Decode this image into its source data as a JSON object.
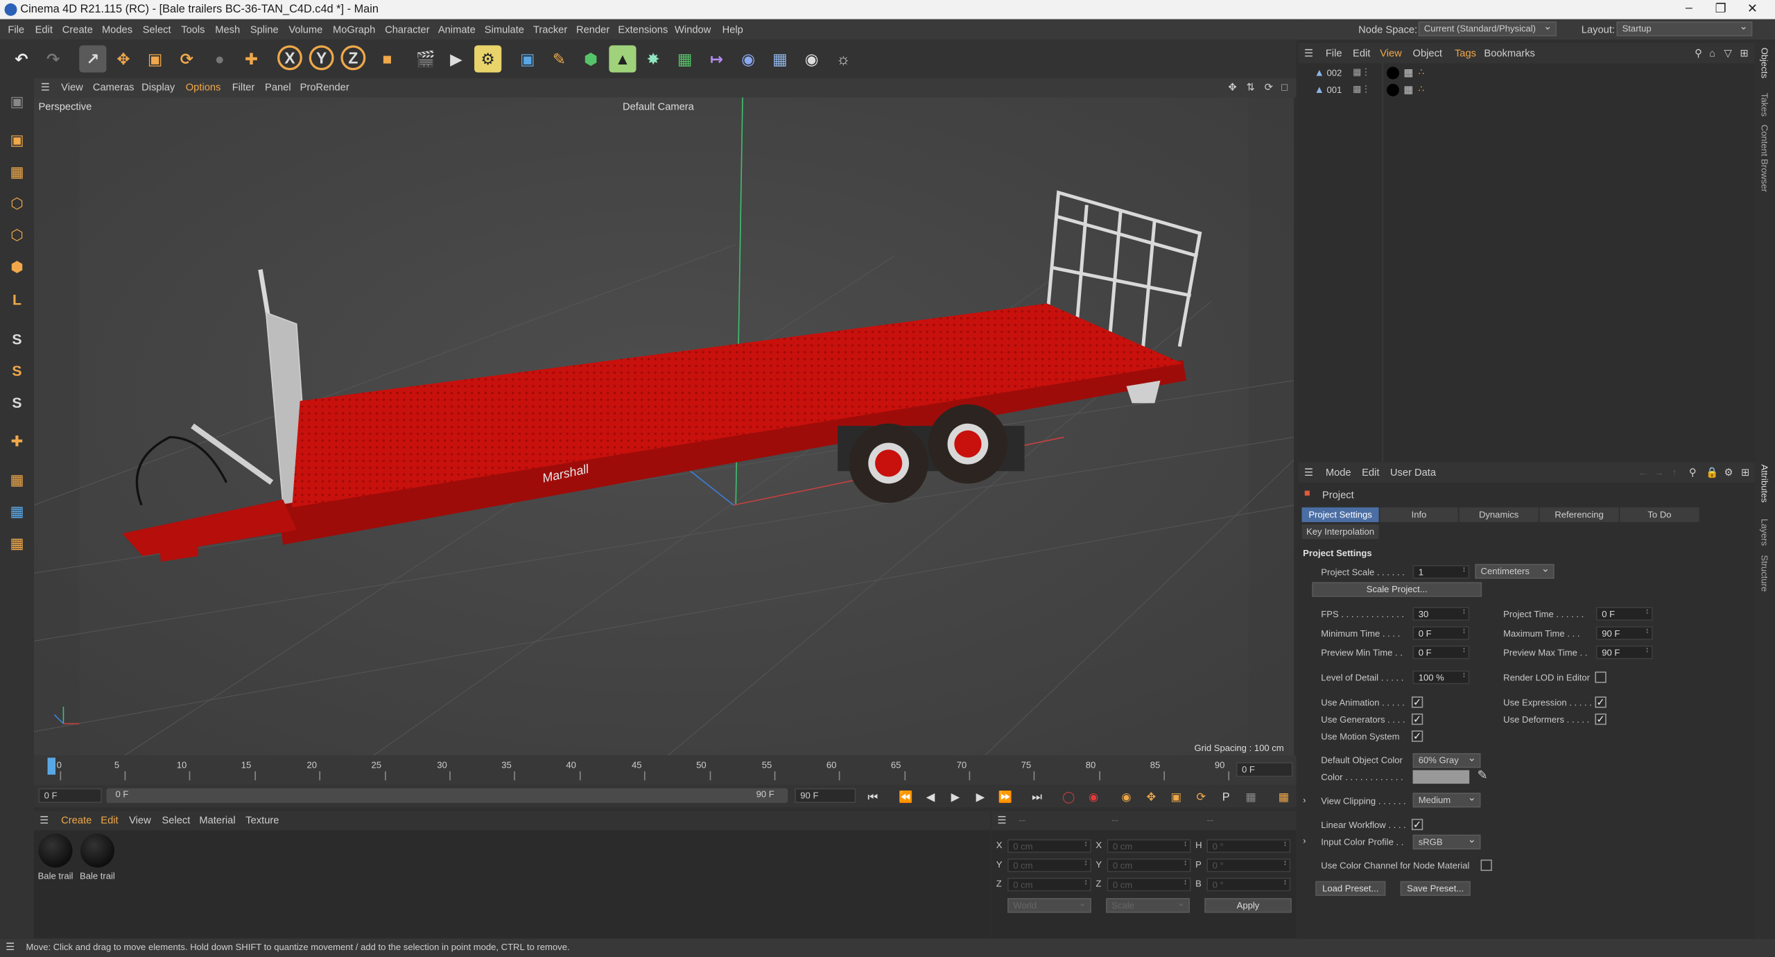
{
  "window": {
    "title": "Cinema 4D R21.115 (RC) - [Bale trailers BC-36-TAN_C4D.c4d *] - Main"
  },
  "menu": [
    "File",
    "Edit",
    "Create",
    "Modes",
    "Select",
    "Tools",
    "Mesh",
    "Spline",
    "Volume",
    "MoGraph",
    "Character",
    "Animate",
    "Simulate",
    "Tracker",
    "Render",
    "Extensions",
    "Window",
    "Help"
  ],
  "nodespace": {
    "label": "Node Space:",
    "value": "Current (Standard/Physical)",
    "layout_label": "Layout:",
    "layout_value": "Startup"
  },
  "viewport_menu": [
    "View",
    "Cameras",
    "Display",
    "Options",
    "Filter",
    "Panel",
    "ProRender"
  ],
  "viewport": {
    "name": "Perspective",
    "camera": "Default Camera",
    "grid_spacing": "Grid Spacing : 100 cm",
    "brand": "Marshall"
  },
  "timeline": {
    "ticks": [
      "0",
      "5",
      "10",
      "15",
      "20",
      "25",
      "30",
      "35",
      "40",
      "45",
      "50",
      "55",
      "60",
      "65",
      "70",
      "75",
      "80",
      "85",
      "90"
    ],
    "end_frame": "0 F"
  },
  "transport": {
    "start": "0 F",
    "current": "0 F",
    "end": "90 F",
    "max": "90 F"
  },
  "materials": {
    "menu": [
      "Create",
      "Edit",
      "View",
      "Select",
      "Material",
      "Texture"
    ],
    "items": [
      {
        "name": "Bale trail"
      },
      {
        "name": "Bale trail"
      }
    ]
  },
  "coords": {
    "rows": [
      {
        "a": "X",
        "v1": "0 cm",
        "b": "X",
        "v2": "0 cm",
        "c": "H",
        "v3": "0 °"
      },
      {
        "a": "Y",
        "v1": "0 cm",
        "b": "Y",
        "v2": "0 cm",
        "c": "P",
        "v3": "0 °"
      },
      {
        "a": "Z",
        "v1": "0 cm",
        "b": "Z",
        "v2": "0 cm",
        "c": "B",
        "v3": "0 °"
      }
    ],
    "world": "World",
    "scale": "Scale",
    "apply": "Apply"
  },
  "status": "Move: Click and drag to move elements. Hold down SHIFT to quantize movement / add to the selection in point mode, CTRL to remove.",
  "objects": {
    "menu": [
      "File",
      "Edit",
      "View",
      "Object",
      "Tags",
      "Bookmarks"
    ],
    "items": [
      {
        "name": "002"
      },
      {
        "name": "001"
      }
    ]
  },
  "attributes": {
    "menu": [
      "Mode",
      "Edit",
      "User Data"
    ],
    "object": "Project",
    "tabs": [
      "Project Settings",
      "Info",
      "Dynamics",
      "Referencing",
      "To Do"
    ],
    "tab2": "Key Interpolation",
    "section": "Project Settings",
    "project_scale_label": "Project Scale . . . . . .",
    "project_scale": "1",
    "units": "Centimeters",
    "scale_btn": "Scale Project...",
    "fps_label": "FPS . . . . . . . . . . . . .",
    "fps": "30",
    "ptime_label": "Project Time . . . . . .",
    "ptime": "0 F",
    "mintime_label": "Minimum Time . . . .",
    "mintime": "0 F",
    "maxtime_label": "Maximum Time . . .",
    "maxtime": "90 F",
    "pmin_label": "Preview Min Time . .",
    "pmin": "0 F",
    "pmax_label": "Preview Max Time . .",
    "pmax": "90 F",
    "lod_label": "Level of Detail . . . . .",
    "lod": "100 %",
    "renderlod_label": "Render LOD in Editor",
    "useanim": "Use Animation . . . . .",
    "useexpr": "Use Expression . . . . .",
    "usegen": "Use Generators . . . .",
    "usedef": "Use Deformers . . . . .",
    "usemotion": "Use Motion System",
    "defcolor_label": "Default Object Color",
    "defcolor": "60% Gray",
    "color_label": "Color . . . . . . . . . . . .",
    "clipping_label": "View Clipping . . . . . .",
    "clipping": "Medium",
    "linear_label": "Linear Workflow . . . .",
    "icp_label": "Input Color Profile . .",
    "icp": "sRGB",
    "colorchan_label": "Use Color Channel for Node Material",
    "load": "Load Preset...",
    "save": "Save Preset..."
  },
  "side_tabs": [
    "Objects",
    "Takes",
    "Content Browser",
    "Attributes",
    "Layers",
    "Structure"
  ],
  "colors": {
    "accent": "#f0a84a",
    "trailer": "#c8100c",
    "viewport_bg": "#444444"
  }
}
